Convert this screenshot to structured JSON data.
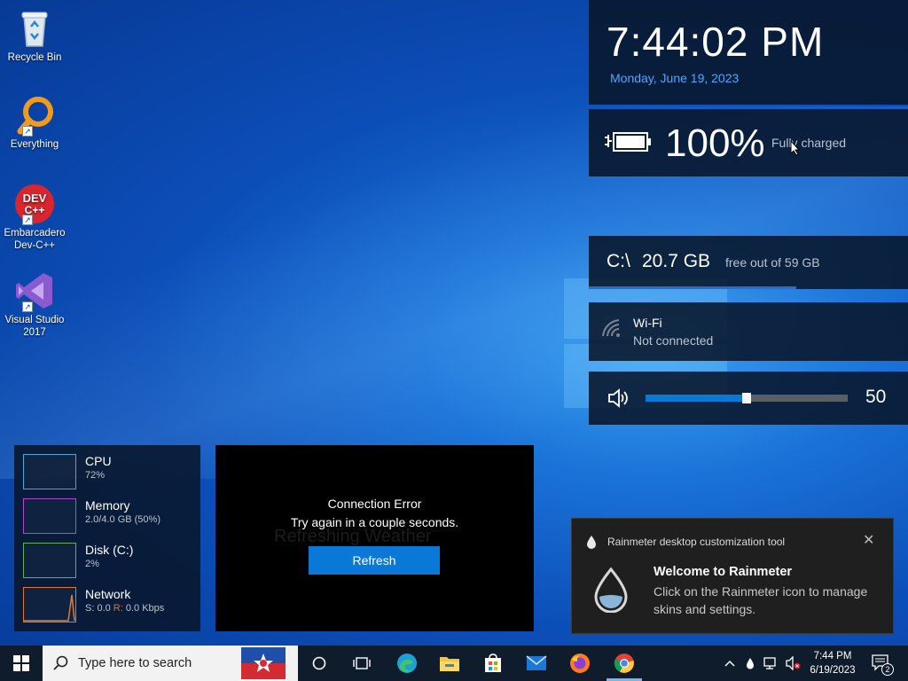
{
  "desktop": {
    "icons": [
      {
        "label": "Recycle Bin"
      },
      {
        "label": "Everything"
      },
      {
        "label": "Embarcadero Dev-C++"
      },
      {
        "label": "Visual Studio 2017"
      }
    ]
  },
  "clock": {
    "time": "7:44:02 PM",
    "date": "Monday, June 19, 2023"
  },
  "battery": {
    "percent": "100%",
    "status": "Fully charged"
  },
  "disk": {
    "drive": "C:\\",
    "free": "20.7 GB",
    "total_text": "free out of 59 GB",
    "used_fraction": 0.65
  },
  "wifi": {
    "name": "Wi-Fi",
    "status": "Not connected"
  },
  "volume": {
    "value": "50",
    "level": 0.5
  },
  "system_monitor": {
    "rows": [
      {
        "label": "CPU",
        "value": "72%",
        "color": "#4aa8d8"
      },
      {
        "label": "Memory",
        "value": "2.0/4.0 GB (50%)",
        "color": "#b14ad0"
      },
      {
        "label": "Disk (C:)",
        "value": "2%",
        "color": "#6ab04c"
      },
      {
        "label": "Network",
        "value_s": "S: 0.0 ",
        "value_r_label": "R:",
        "value_r": " 0.0 Kbps",
        "color": "#e07a30"
      }
    ]
  },
  "weather": {
    "ghost_text": "Refreshing Weather",
    "error_title": "Connection Error",
    "error_message": "Try again in a couple seconds.",
    "refresh_label": "Refresh"
  },
  "toast": {
    "app_name": "Rainmeter desktop customization tool",
    "close_glyph": "✕",
    "title": "Welcome to Rainmeter",
    "body": "Click on the Rainmeter icon to manage skins and settings."
  },
  "taskbar": {
    "search_placeholder": "Type here to search",
    "apps": [
      "cortana",
      "task-view",
      "edge",
      "file-explorer",
      "store",
      "mail",
      "firefox",
      "chrome"
    ],
    "tray_time": "7:44 PM",
    "tray_date": "6/19/2023",
    "notification_count": "2"
  },
  "colors": {
    "accent": "#0a78d7",
    "panel": "#08162a",
    "date_blue": "#4ba8ff"
  }
}
